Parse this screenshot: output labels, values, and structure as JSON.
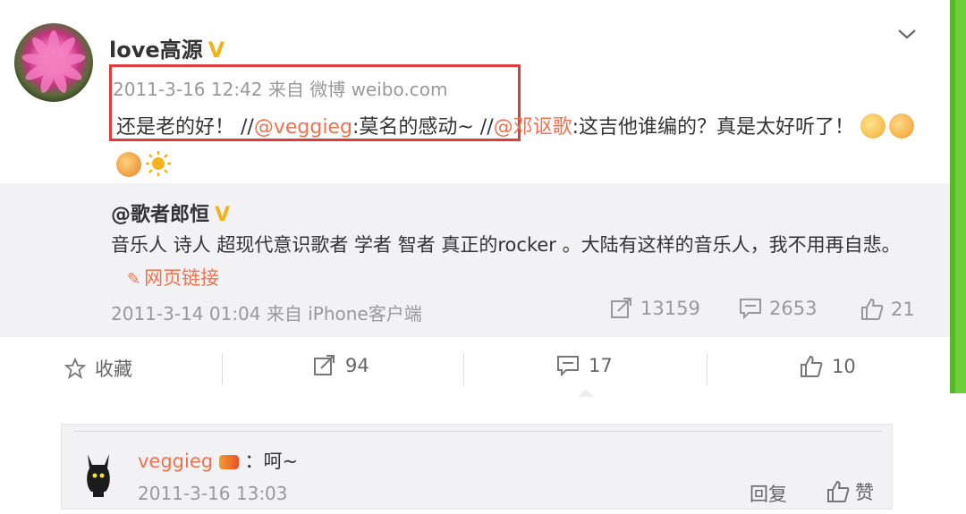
{
  "post": {
    "username": "love高源",
    "verified_badge": "V",
    "time": "2011-3-16 12:42",
    "source": "来自 微博 weibo.com",
    "text_part1": "还是老的好！ //",
    "mention1": "@veggieg",
    "text_part2": ":莫名的感动~ //",
    "mention2": "@邓讴歌",
    "text_part3": ":这吉他谁编的？真是太好听了！"
  },
  "quoted": {
    "username": "@歌者郎恒",
    "verified_badge": "V",
    "text": "音乐人 诗人 超现代意识歌者 学者 智者 真正的rocker 。大陆有这样的音乐人，我不用再自悲。",
    "link_label": "网页链接",
    "time": "2011-3-14 01:04",
    "source": "来自 iPhone客户端",
    "repost_count": "13159",
    "comment_count": "2653",
    "like_count": "21"
  },
  "actions": {
    "favorite_label": "收藏",
    "repost_count": "94",
    "comment_count": "17",
    "like_count": "10"
  },
  "comment": {
    "username": "veggieg",
    "text": "：呵~",
    "time": "2011-3-16 13:03",
    "reply_label": "回复",
    "like_label": "赞"
  },
  "colors": {
    "mention": "#eb7350",
    "highlight_box": "#e03a3a",
    "verified": "#f3b21a",
    "side_strip": "#6fcf3a"
  }
}
